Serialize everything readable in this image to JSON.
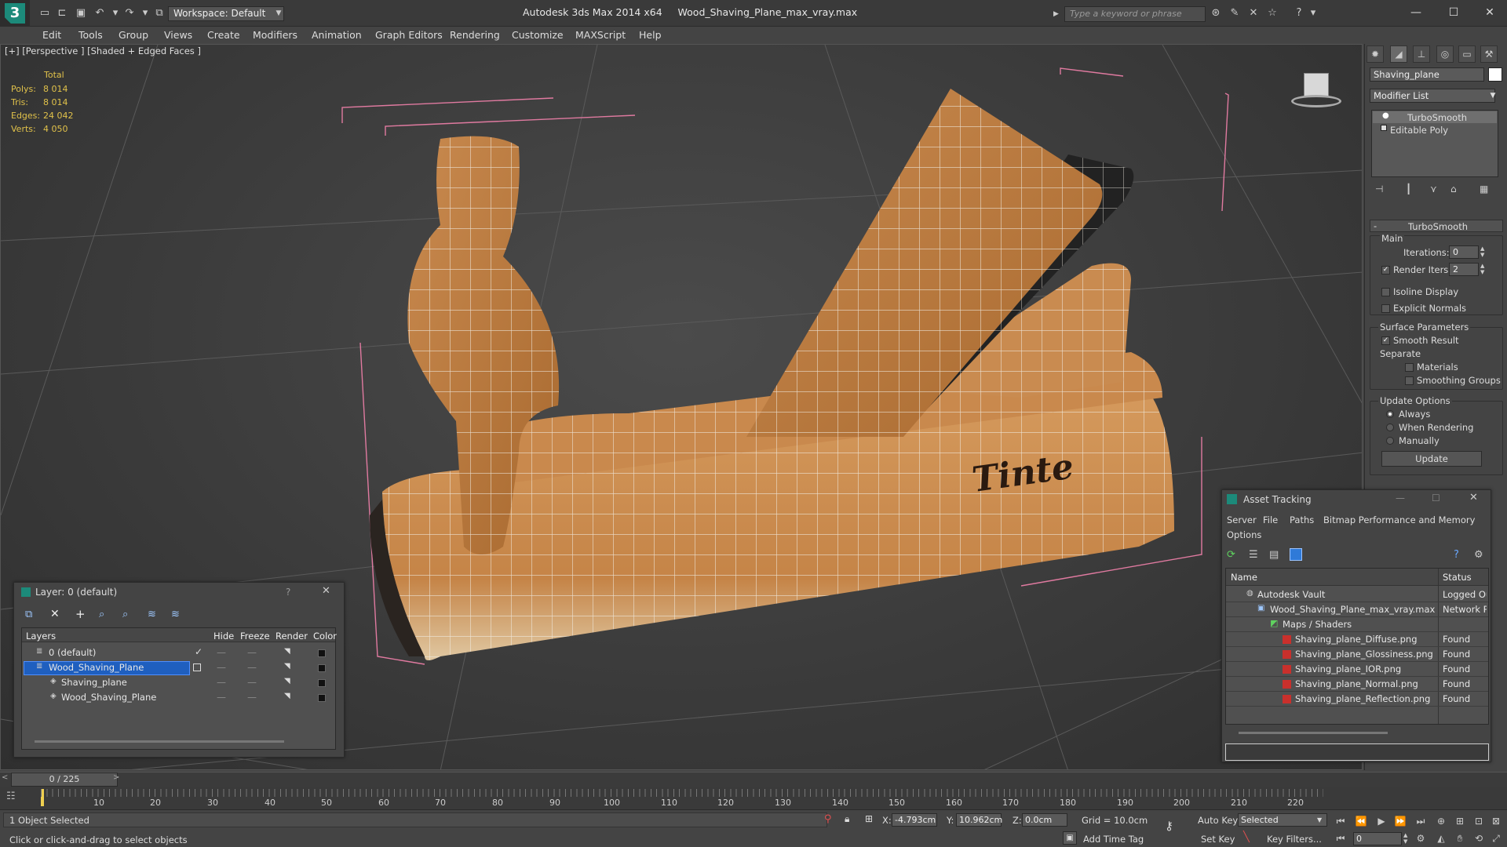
{
  "app": {
    "title": "Autodesk 3ds Max  2014 x64",
    "file": "Wood_Shaving_Plane_max_vray.max",
    "workspace": "Workspace: Default",
    "search_placeholder": "Type a keyword or phrase"
  },
  "menu": [
    "Edit",
    "Tools",
    "Group",
    "Views",
    "Create",
    "Modifiers",
    "Animation",
    "Graph Editors",
    "Rendering",
    "Customize",
    "MAXScript",
    "Help"
  ],
  "viewport": {
    "label": "[+] [Perspective ] [Shaded + Edged Faces ]",
    "stats_header": "Total",
    "stats": [
      {
        "label": "Polys:",
        "value": "8 014"
      },
      {
        "label": "Tris:",
        "value": "8 014"
      },
      {
        "label": "Edges:",
        "value": "24 042"
      },
      {
        "label": "Verts:",
        "value": "4 050"
      }
    ],
    "logo_text": "Tinte"
  },
  "command_panel": {
    "object_name": "Shaving_plane",
    "modifier_list": "Modifier List",
    "stack": [
      "TurboSmooth",
      "Editable Poly"
    ],
    "rollout_title": "TurboSmooth",
    "main_label": "Main",
    "iterations_label": "Iterations:",
    "iterations_value": "0",
    "render_iters_label": "Render Iters:",
    "render_iters_value": "2",
    "isoline_label": "Isoline Display",
    "explicit_label": "Explicit Normals",
    "surface_label": "Surface Parameters",
    "smooth_result_label": "Smooth Result",
    "separate_label": "Separate",
    "materials_label": "Materials",
    "smoothing_groups_label": "Smoothing Groups",
    "update_options_label": "Update Options",
    "always_label": "Always",
    "when_rendering_label": "When Rendering",
    "manually_label": "Manually",
    "update_button": "Update"
  },
  "layer_dialog": {
    "title": "Layer: 0 (default)",
    "help": "?",
    "columns": [
      "Layers",
      "Hide",
      "Freeze",
      "Render",
      "Color"
    ],
    "rows": [
      {
        "name": "0 (default)",
        "indent": 0,
        "selected": false
      },
      {
        "name": "Wood_Shaving_Plane",
        "indent": 0,
        "selected": true
      },
      {
        "name": "Shaving_plane",
        "indent": 1,
        "selected": false
      },
      {
        "name": "Wood_Shaving_Plane",
        "indent": 1,
        "selected": false
      }
    ]
  },
  "asset_dialog": {
    "title": "Asset Tracking",
    "menu": [
      "Server",
      "File",
      "Paths",
      "Bitmap Performance and Memory",
      "Options"
    ],
    "columns": [
      "Name",
      "Status"
    ],
    "rows": [
      {
        "name": "Autodesk Vault",
        "status": "Logged Ou",
        "indent": 0
      },
      {
        "name": "Wood_Shaving_Plane_max_vray.max",
        "status": "Network P",
        "indent": 1
      },
      {
        "name": "Maps / Shaders",
        "status": "",
        "indent": 2
      },
      {
        "name": "Shaving_plane_Diffuse.png",
        "status": "Found",
        "indent": 3
      },
      {
        "name": "Shaving_plane_Glossiness.png",
        "status": "Found",
        "indent": 3
      },
      {
        "name": "Shaving_plane_IOR.png",
        "status": "Found",
        "indent": 3
      },
      {
        "name": "Shaving_plane_Normal.png",
        "status": "Found",
        "indent": 3
      },
      {
        "name": "Shaving_plane_Reflection.png",
        "status": "Found",
        "indent": 3
      }
    ]
  },
  "timeline": {
    "frame": "0 / 225",
    "ticks": [
      "10",
      "20",
      "30",
      "40",
      "50",
      "60",
      "70",
      "80",
      "90",
      "100",
      "110",
      "120",
      "130",
      "140",
      "150",
      "160",
      "170",
      "180",
      "190",
      "200",
      "210",
      "220"
    ]
  },
  "status": {
    "selection": "1 Object Selected",
    "prompt": "Click or click-and-drag to select objects",
    "x_label": "X:",
    "x_value": "-4.793cm",
    "y_label": "Y:",
    "y_value": "10.962cm",
    "z_label": "Z:",
    "z_value": "0.0cm",
    "grid": "Grid = 10.0cm",
    "add_time_tag": "Add Time Tag",
    "auto_key": "Auto Key",
    "selected_value": "Selected",
    "set_key": "Set Key",
    "key_filters": "Key Filters...",
    "frame_value": "0"
  }
}
